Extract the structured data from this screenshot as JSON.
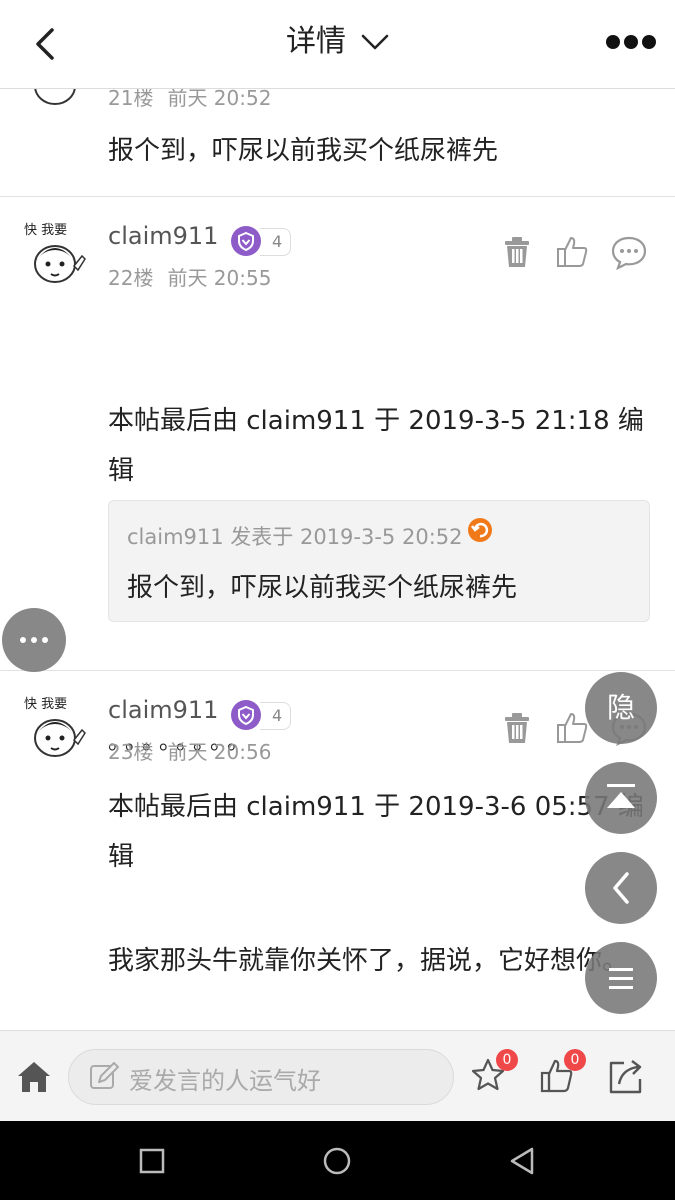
{
  "header": {
    "title": "详情"
  },
  "partial_post": {
    "floor": "21楼",
    "time": "前天 20:52",
    "text": "报个到，吓尿以前我买个纸尿裤先"
  },
  "posts": [
    {
      "username": "claim911",
      "level": "4",
      "floor": "22楼",
      "time": "前天 20:55",
      "edit_note": "本帖最后由 claim911 于 2019-3-5 21:18 编辑",
      "quote": {
        "meta": "claim911 发表于 2019-3-5 20:52",
        "text": "报个到，吓尿以前我买个纸尿裤先"
      },
      "body": "。。。。。。。。"
    },
    {
      "username": "claim911",
      "level": "4",
      "floor": "23楼",
      "time": "前天 20:56",
      "edit_note": "本帖最后由 claim911 于 2019-3-6 05:57 编辑",
      "body": "我家那头牛就靠你关怀了，据说，它好想你。"
    }
  ],
  "avatar_caption": "快 我要",
  "floating": {
    "hide_label": "隐"
  },
  "bottom_bar": {
    "reply_placeholder": "爱发言的人运气好",
    "favorite_count": "0",
    "like_count": "0"
  },
  "colors": {
    "level_badge": "#8e5cc9",
    "count_badge": "#f04848",
    "fab": "#787878"
  },
  "icons": [
    "back-icon",
    "chevron-down-icon",
    "more-icon",
    "trash-icon",
    "thumbs-up-icon",
    "comment-icon",
    "quote-jump-icon",
    "home-icon",
    "edit-icon",
    "star-icon",
    "share-icon",
    "scroll-top-icon",
    "menu-icon"
  ]
}
